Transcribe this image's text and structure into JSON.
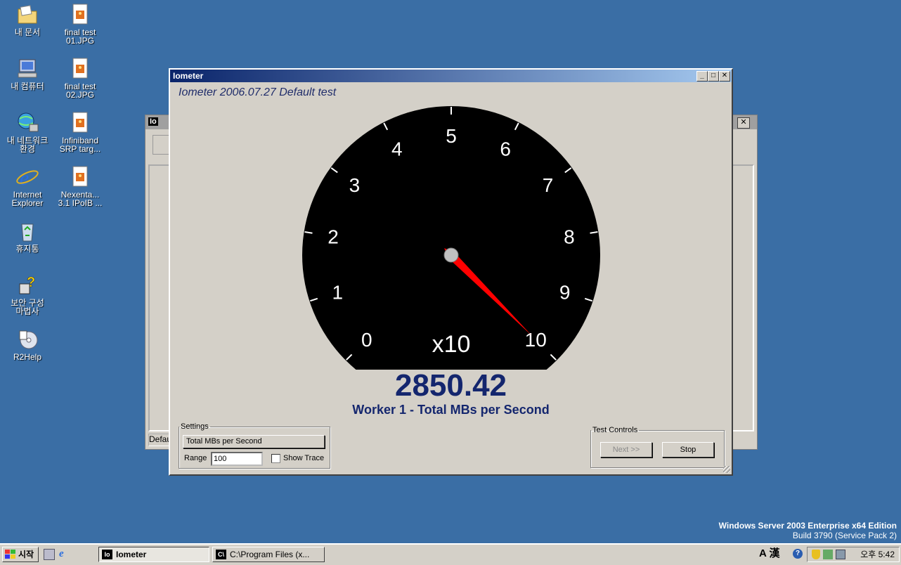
{
  "desktop": {
    "icons": [
      {
        "label": "내 문서",
        "icon": "folder-icon"
      },
      {
        "label": "final test\n01.JPG",
        "icon": "image-file-icon"
      },
      {
        "label": "내 컴퓨터",
        "icon": "computer-icon"
      },
      {
        "label": "final test\n02.JPG",
        "icon": "image-file-icon"
      },
      {
        "label": "내 네트워크\n환경",
        "icon": "network-icon"
      },
      {
        "label": "Infiniband\nSRP targ...",
        "icon": "image-file-icon"
      },
      {
        "label": "Internet\nExplorer",
        "icon": "ie-icon"
      },
      {
        "label": "Nexenta...\n3.1 IPoIB ...",
        "icon": "image-file-icon"
      },
      {
        "label": "휴지통",
        "icon": "recycle-bin-icon"
      },
      {
        "label": "보안 구성\n마법사",
        "icon": "security-wizard-icon"
      },
      {
        "label": "R2Help",
        "icon": "help-cd-icon"
      }
    ],
    "os_line1": "Windows Server 2003 Enterprise x64 Edition",
    "os_line2": "Build 3790 (Service Pack 2)"
  },
  "background_window": {
    "title_fragment": "Io",
    "status_text": "Defau"
  },
  "meter_window": {
    "title": "Iometer",
    "heading": "Iometer 2006.07.27 Default test",
    "gauge": {
      "scale_labels": [
        "0",
        "1",
        "2",
        "3",
        "4",
        "5",
        "6",
        "7",
        "8",
        "9",
        "10"
      ],
      "multiplier": "x10",
      "needle_value": 2850.42,
      "scale_max": 100
    },
    "readout_value": "2850.42",
    "readout_label": "Worker 1 - Total MBs per Second",
    "settings": {
      "legend": "Settings",
      "metric_button": "Total MBs per Second",
      "range_label": "Range",
      "range_value": "100",
      "show_trace_label": "Show Trace",
      "show_trace_checked": false
    },
    "test_controls": {
      "legend": "Test Controls",
      "next_button": "Next >>",
      "stop_button": "Stop"
    }
  },
  "taskbar": {
    "start_label": "시작",
    "tasks": [
      {
        "label": "Iometer",
        "active": true
      },
      {
        "label": "C:\\Program Files (x...",
        "active": false
      }
    ],
    "tray_ime": "A 漢",
    "clock": "오후 5:42"
  },
  "colors": {
    "desktop": "#3a6ea5",
    "needle": "#ff0000",
    "readout": "#14266e"
  }
}
